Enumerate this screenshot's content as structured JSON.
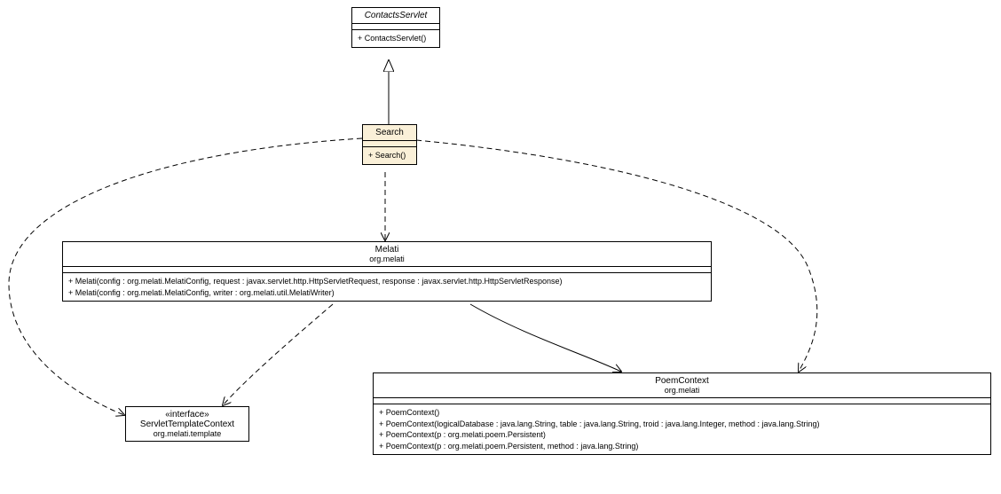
{
  "classes": {
    "contactsServlet": {
      "name": "ContactsServlet",
      "methods": [
        "+ ContactsServlet()"
      ]
    },
    "search": {
      "name": "Search",
      "methods": [
        "+ Search()"
      ]
    },
    "melati": {
      "name": "Melati",
      "package": "org.melati",
      "methods": [
        "+ Melati(config : org.melati.MelatiConfig, request : javax.servlet.http.HttpServletRequest, response : javax.servlet.http.HttpServletResponse)",
        "+ Melati(config : org.melati.MelatiConfig, writer : org.melati.util.MelatiWriter)"
      ]
    },
    "servletTemplateContext": {
      "stereotype": "«interface»",
      "name": "ServletTemplateContext",
      "package": "org.melati.template"
    },
    "poemContext": {
      "name": "PoemContext",
      "package": "org.melati",
      "methods": [
        "+ PoemContext()",
        "+ PoemContext(logicalDatabase : java.lang.String, table : java.lang.String, troid : java.lang.Integer, method : java.lang.String)",
        "+ PoemContext(p : org.melati.poem.Persistent)",
        "+ PoemContext(p : org.melati.poem.Persistent, method : java.lang.String)"
      ]
    }
  }
}
